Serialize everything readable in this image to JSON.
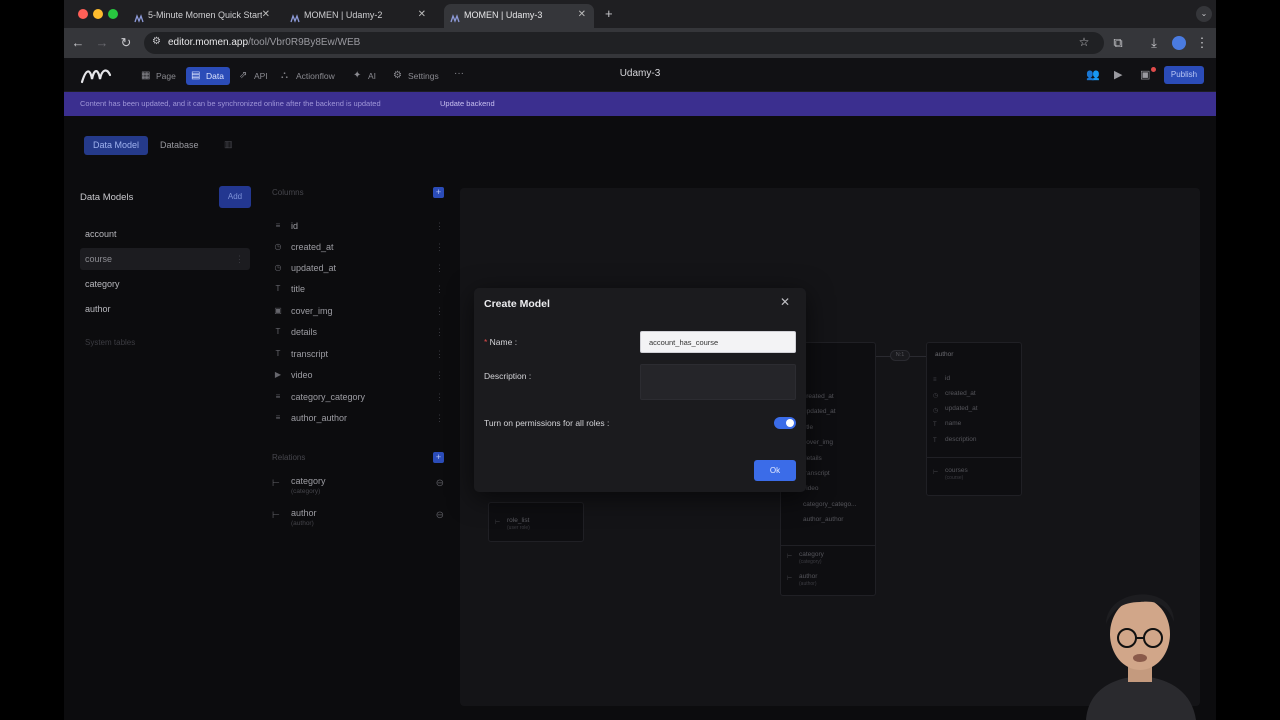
{
  "browser": {
    "tabs": [
      {
        "title": "5-Minute Momen Quick Start"
      },
      {
        "title": "MOMEN | Udamy-2"
      },
      {
        "title": "MOMEN | Udamy-3"
      }
    ],
    "url_host": "editor.momen.app",
    "url_path": "/tool/Vbr0R9By8Ew/WEB"
  },
  "app": {
    "nav": [
      {
        "label": "Page",
        "icon": "page-icon"
      },
      {
        "label": "Data",
        "icon": "data-icon"
      },
      {
        "label": "API",
        "icon": "api-icon"
      },
      {
        "label": "Actionflow",
        "icon": "actionflow-icon"
      },
      {
        "label": "AI",
        "icon": "ai-icon"
      },
      {
        "label": "Settings",
        "icon": "gear-icon"
      }
    ],
    "project_title": "Udamy-3",
    "publish_label": "Publish"
  },
  "banner": {
    "text": "Content has been updated, and it can be synchronized online after the backend is updated",
    "action": "Update backend",
    "color": "#3b2f8f"
  },
  "subnav": {
    "data_model": "Data Model",
    "database": "Database"
  },
  "models": {
    "title": "Data Models",
    "add_label": "Add",
    "items": [
      "account",
      "course",
      "category",
      "author"
    ],
    "selected": "course",
    "system_tables": "System tables"
  },
  "columns": {
    "header": "Columns",
    "items": [
      "id",
      "created_at",
      "updated_at",
      "title",
      "cover_img",
      "details",
      "transcript",
      "video",
      "category_category",
      "author_author"
    ]
  },
  "relations": {
    "header": "Relations",
    "items": [
      {
        "name": "category",
        "sub": "(category)"
      },
      {
        "name": "author",
        "sub": "(author)"
      }
    ]
  },
  "canvas": {
    "small_card": {
      "field": "role_list",
      "sub": "(user role)"
    },
    "course_card": {
      "fields": [
        "created_at",
        "updated_at",
        "title",
        "cover_img",
        "details",
        "transcript",
        "video",
        "category_catego...",
        "author_author"
      ],
      "relations": [
        {
          "name": "category",
          "sub": "(category)"
        },
        {
          "name": "author",
          "sub": "(author)"
        }
      ]
    },
    "relation_badge": "N:1",
    "author_card": {
      "title": "author",
      "fields": [
        "id",
        "created_at",
        "updated_at",
        "name",
        "description"
      ],
      "relation": {
        "name": "courses",
        "sub": "(course)"
      }
    }
  },
  "modal": {
    "title": "Create Model",
    "name_label": "Name :",
    "name_value": "account_has_course",
    "description_label": "Description :",
    "description_value": "",
    "permissions_label": "Turn on permissions for all roles :",
    "permissions_on": true,
    "ok_label": "Ok",
    "accent": "#3b6ce8"
  }
}
